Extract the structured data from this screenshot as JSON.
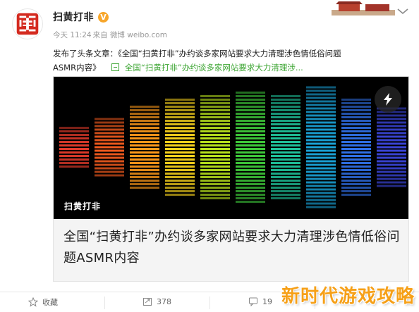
{
  "account": {
    "name": "扫黄打非",
    "verified_mark": "V",
    "time": "今天 11:24",
    "source": "来自 微博 weibo.com"
  },
  "post": {
    "line1": "发布了头条文章：《全国“扫黄打非”办约谈多家网站要求大力清理涉色情低俗问题",
    "line2": "ASMR内容》",
    "link_text": "全国“扫黄打非”办约谈多家网站要求大力清理涉..."
  },
  "card": {
    "image_tag": "扫黄打非",
    "title": "全国“扫黄打非”办约谈多家网站要求大力清理涉色情低俗问题ASMR内容"
  },
  "actions": {
    "favorite": "收藏",
    "repost": "378",
    "comment": "19",
    "like": ""
  },
  "watermark": "新时代游戏攻略",
  "icons": [
    "seal-avatar-icon",
    "verified-icon",
    "chevron-down-icon",
    "link-icon",
    "flash-icon",
    "star-icon",
    "repost-icon",
    "comment-icon"
  ],
  "colors": {
    "link": "#3ea634",
    "verified": "#f7a62b",
    "watermark": "#f6a018"
  }
}
